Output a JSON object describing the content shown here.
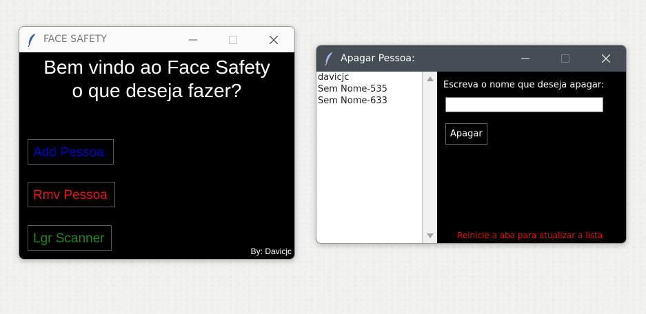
{
  "window_main": {
    "title": "FACE SAFETY",
    "welcome_text": "Bem vindo ao Face Safety\no que deseja fazer?",
    "buttons": {
      "add": {
        "label": "Add Pessoa",
        "color": "#0000cc"
      },
      "rmv": {
        "label": "Rmv Pessoa",
        "color": "#ee1111"
      },
      "lgr": {
        "label": "Lgr Scanner",
        "color": "#1a8a1a"
      }
    },
    "author": "By: Davicjc"
  },
  "window_delete": {
    "title": "Apagar Pessoa:",
    "list_items": [
      "davicjc",
      "Sem Nome-535",
      "Sem Nome-633"
    ],
    "prompt": "Escreva o nome que deseja apagar:",
    "name_input_value": "",
    "delete_button": "Apagar",
    "refresh_note": "Reinicie a aba para atualizar a lista"
  },
  "icons": {
    "app": "feather-icon",
    "minimize": "minimize-icon",
    "maximize": "maximize-icon",
    "close": "close-icon"
  }
}
